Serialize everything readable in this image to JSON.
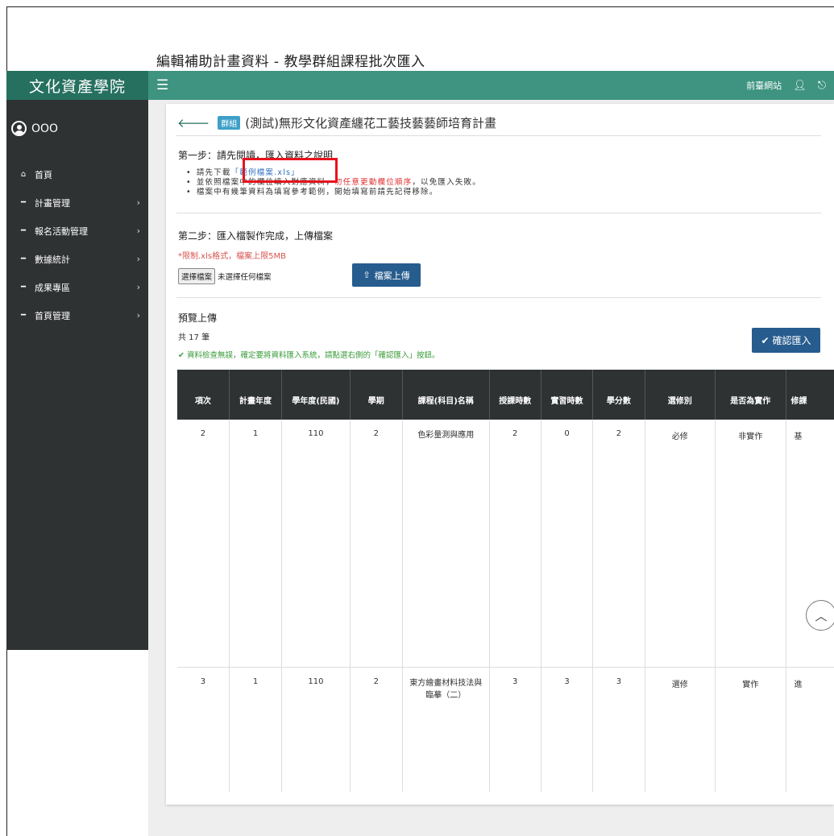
{
  "page": {
    "heading": "編輯補助計畫資料 - 教學群組課程批次匯入"
  },
  "topbar": {
    "brand": "文化資產學院",
    "frontsite_label": "前臺網站"
  },
  "sidebar": {
    "user_name": "OOO",
    "items": [
      {
        "label": "首頁",
        "icon": "home-icon",
        "has_children": false
      },
      {
        "label": "計畫管理",
        "icon": "minus-icon",
        "has_children": true
      },
      {
        "label": "報名活動管理",
        "icon": "minus-icon",
        "has_children": true
      },
      {
        "label": "數據統計",
        "icon": "minus-icon",
        "has_children": true
      },
      {
        "label": "成果專區",
        "icon": "minus-icon",
        "has_children": true
      },
      {
        "label": "首頁管理",
        "icon": "minus-icon",
        "has_children": true
      }
    ]
  },
  "card": {
    "badge": "群組",
    "title": "(測試)無形文化資產纏花工藝技藝藝師培育計畫",
    "step1": {
      "title": "第一步：請先閱讀，匯入資料之說明",
      "b1_prefix": "請先下載",
      "b1_link": "「範例檔案.xls」",
      "b2_prefix": "並依照檔案中的欄位填入對應資料，",
      "b2_warn": "勿任意更動欄位順序",
      "b2_suffix": "，以免匯入失敗。",
      "b3": "檔案中有幾筆資料為填寫參考範例，開始填寫前請先記得移除。"
    },
    "step2": {
      "title": "第二步：匯入檔製作完成，上傳檔案",
      "note": "*限制.xls格式，檔案上限5MB",
      "choose_label": "選擇檔案",
      "no_file": "未選擇任何檔案",
      "upload_label": "檔案上傳"
    },
    "preview": {
      "title": "預覽上傳",
      "count": "共 17 筆",
      "ok_msg": "資料檢查無誤，確定要將資料匯入系統，請點選右側的「確認匯入」按鈕。",
      "confirm_label": "確認匯入"
    }
  },
  "table": {
    "headers": [
      "項次",
      "計畫年度",
      "學年度(民國)",
      "學期",
      "課程(科目)名稱",
      "授課時數",
      "實習時數",
      "學分數",
      "選修別",
      "是否為實作",
      "修課"
    ],
    "rows": [
      [
        "2",
        "1",
        "110",
        "2",
        "色彩量測與應用",
        "2",
        "0",
        "2",
        "必修",
        "非實作",
        "基"
      ],
      [
        "3",
        "1",
        "110",
        "2",
        "東方繪畫材料技法與臨摹（二）",
        "3",
        "3",
        "3",
        "選修",
        "實作",
        "進"
      ]
    ]
  }
}
